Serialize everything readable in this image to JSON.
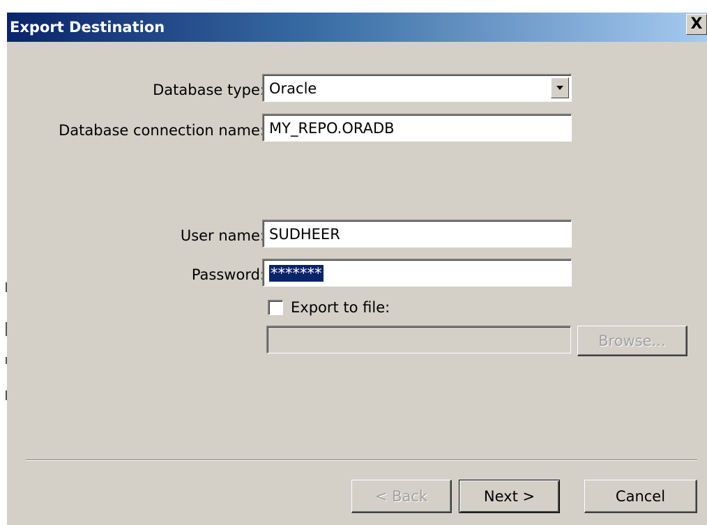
{
  "window": {
    "title": "Export Destination",
    "close_glyph": "X"
  },
  "form": {
    "database_type": {
      "label": "Database type:",
      "value": "Oracle"
    },
    "connection_name": {
      "label": "Database connection name:",
      "value": "MY_REPO.ORADB"
    },
    "user_name": {
      "label": "User name:",
      "value": "SUDHEER"
    },
    "password": {
      "label": "Password:",
      "value": "*******"
    },
    "export_to_file": {
      "label": "Export to file:",
      "checked": false,
      "path_value": ""
    }
  },
  "buttons": {
    "browse": "Browse...",
    "back": "< Back",
    "next": "Next >",
    "cancel": "Cancel"
  },
  "icons": {
    "close": "close-icon",
    "dropdown": "chevron-down-icon"
  },
  "colors": {
    "titlebar_start": "#0a246a",
    "titlebar_end": "#a6caf0",
    "dialog_face": "#d4d0c8",
    "selection": "#0a246a"
  }
}
